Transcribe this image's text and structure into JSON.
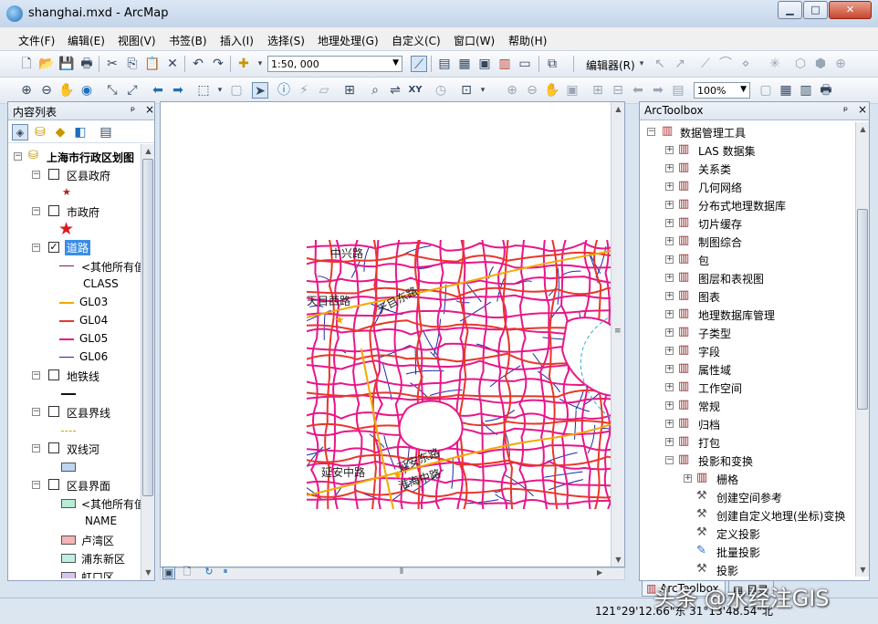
{
  "window": {
    "title": "shanghai.mxd - ArcMap",
    "controls": {
      "minimize": "▁",
      "maximize": "□",
      "close": "✕"
    }
  },
  "menu": [
    "文件(F)",
    "编辑(E)",
    "视图(V)",
    "书签(B)",
    "插入(I)",
    "选择(S)",
    "地理处理(G)",
    "自定义(C)",
    "窗口(W)",
    "帮助(H)"
  ],
  "toolbar": {
    "scale_value": "1:50, 000",
    "editor_label": "编辑器(R)",
    "zoom_value": "100%"
  },
  "toc": {
    "title": "内容列表",
    "pin": "ᵖ",
    "close": "×",
    "dataframe": "上海市行政区划图",
    "layers": [
      {
        "name": "区县政府",
        "checked": false,
        "symbol": "star-small",
        "color": "#b0202a"
      },
      {
        "name": "市政府",
        "checked": false,
        "symbol": "star-large",
        "color": "#e0151f"
      },
      {
        "name": "道路",
        "checked": true,
        "selected": true,
        "legend_heading": "CLASS",
        "other_label": "<其他所有值>",
        "classes": [
          {
            "label": "GL03",
            "color": "#f2a900"
          },
          {
            "label": "GL04",
            "color": "#e8362a"
          },
          {
            "label": "GL05",
            "color": "#e8168a"
          },
          {
            "label": "GL06",
            "color": "#1a2aa8"
          }
        ]
      },
      {
        "name": "地铁线",
        "checked": false,
        "symbol": "line",
        "color": "#111111"
      },
      {
        "name": "区县界线",
        "checked": false,
        "symbol": "dash",
        "color": "#d4a000"
      },
      {
        "name": "双线河",
        "checked": false,
        "symbol": "box",
        "color": "#bcd6f2"
      },
      {
        "name": "区县界面",
        "checked": false,
        "legend_heading": "NAME",
        "other_label": "<其他所有值>",
        "other_color": "#b8ecd4",
        "classes": [
          {
            "label": "卢湾区",
            "color": "#f4b4b8"
          },
          {
            "label": "浦东新区",
            "color": "#bdf0e6"
          },
          {
            "label": "虹口区",
            "color": "#d6c4f4"
          }
        ]
      }
    ]
  },
  "map": {
    "background": "#ffffff",
    "road_colors": {
      "GL03": "#f2a900",
      "GL04": "#e8362a",
      "GL05": "#e8168a",
      "GL06": "#1a2aa8"
    },
    "labels": [
      "中兴路",
      "天目西路",
      "天目东路",
      "延安中路",
      "延安东路",
      "淮海中路"
    ]
  },
  "toolbox": {
    "title": "ArcToolbox",
    "root": "数据管理工具",
    "toolsets": [
      "LAS 数据集",
      "关系类",
      "几何网络",
      "分布式地理数据库",
      "切片缓存",
      "制图综合",
      "包",
      "图层和表视图",
      "图表",
      "地理数据库管理",
      "子类型",
      "字段",
      "属性域",
      "工作空间",
      "常规",
      "归档",
      "打包",
      "投影和变换"
    ],
    "expanded": {
      "raster": "栅格",
      "tools": [
        "创建空间参考",
        "创建自定义地理(坐标)变换",
        "定义投影",
        "批量投影",
        "投影"
      ]
    },
    "tabs": [
      "ArcToolbox",
      "目录"
    ]
  },
  "status": {
    "coordinates": "121°29'12.66\"东  31°13'48.54\"北"
  },
  "watermark": "头条 @水经注GIS"
}
